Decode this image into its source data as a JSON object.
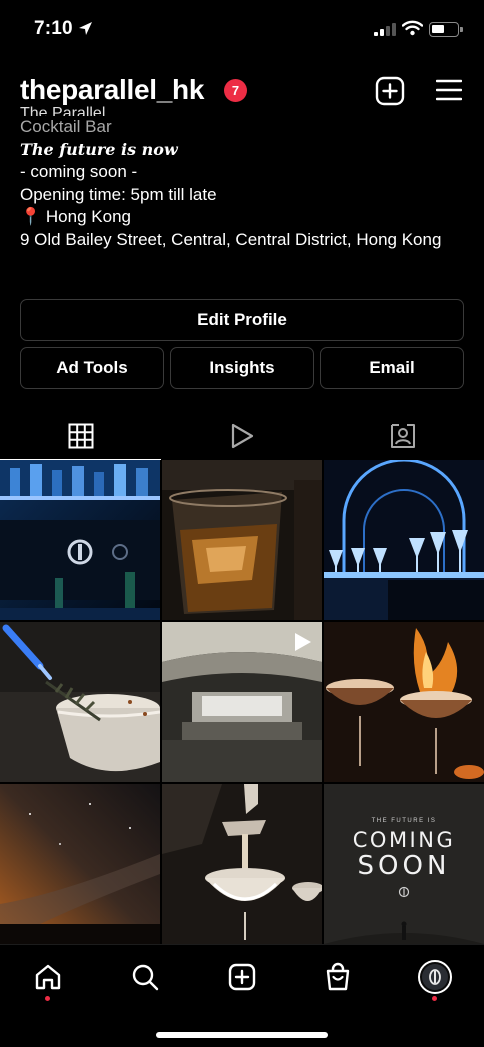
{
  "status_bar": {
    "time": "7:10"
  },
  "header": {
    "username": "theparallel_hk",
    "notification_count": "7"
  },
  "bio": {
    "name_cut": "The Parallel",
    "category": "Cocktail Bar",
    "tagline": "The future is now",
    "line_coming": "- coming soon -",
    "line_hours": "Opening time: 5pm till late",
    "pin_emoji": "📍",
    "line_city": "Hong Kong",
    "line_address": "9 Old Bailey Street, Central, Central District, Hong Kong"
  },
  "buttons": {
    "edit_profile": "Edit Profile",
    "ad_tools": "Ad Tools",
    "insights": "Insights",
    "email": "Email"
  },
  "grid": {
    "coming_soon_small": "THE FUTURE IS",
    "coming_soon_line1": "COMING",
    "coming_soon_line2": "SOON"
  },
  "colors": {
    "accent": "#ed2d45",
    "button_border": "#3a3a3a",
    "background": "#000000"
  },
  "icons": {
    "tabs": [
      "grid-icon",
      "reels-icon",
      "tagged-icon"
    ],
    "nav": [
      "home-icon",
      "search-icon",
      "create-icon",
      "shop-icon",
      "profile-avatar"
    ]
  }
}
